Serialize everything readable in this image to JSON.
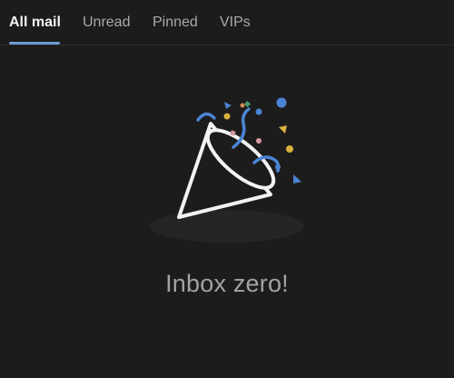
{
  "tabs": [
    {
      "label": "All mail",
      "active": true
    },
    {
      "label": "Unread",
      "active": false
    },
    {
      "label": "Pinned",
      "active": false
    },
    {
      "label": "VIPs",
      "active": false
    }
  ],
  "empty_state": {
    "message": "Inbox zero!",
    "illustration_icon": "party-popper-icon"
  },
  "colors": {
    "background": "#1c1c1c",
    "tab_active_text": "#f2f2f2",
    "tab_inactive_text": "#a9a9a9",
    "accent": "#6f9ad6",
    "confetti_blue": "#4b84d4",
    "confetti_yellow": "#d8b13c",
    "confetti_pink": "#d89aa3",
    "confetti_green": "#4c9a6c"
  }
}
